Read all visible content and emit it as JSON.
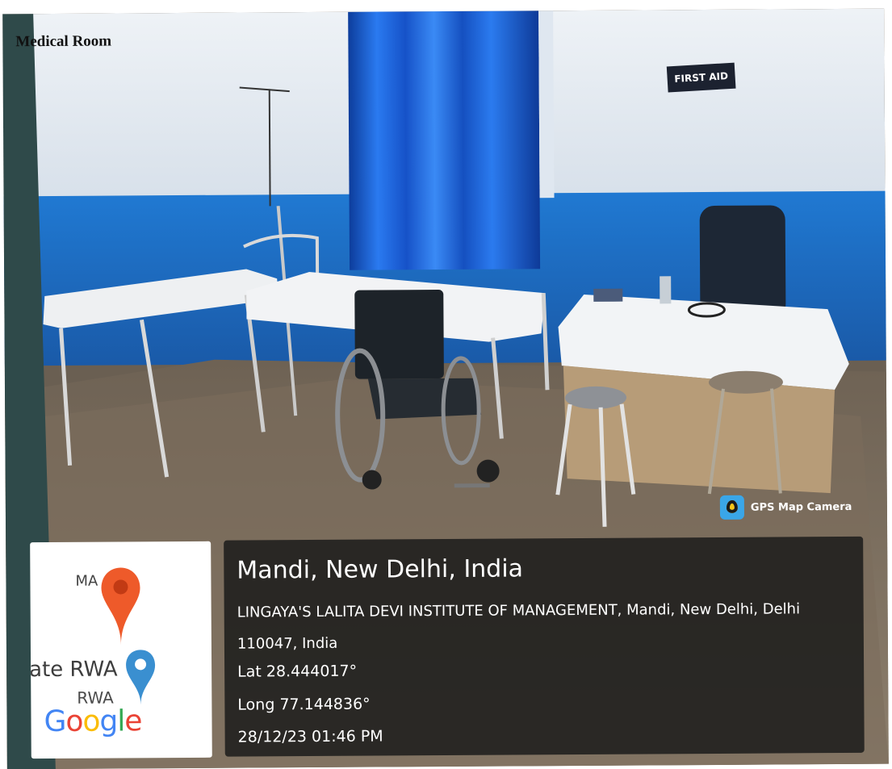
{
  "caption": "Medical Room",
  "sign_text": "FIRST AID",
  "gps_badge": {
    "app_name": "GPS Map Camera",
    "icon": "gps-map-camera-app-icon"
  },
  "map_tile": {
    "label_top": "MA",
    "label_rwa_large": "ate RWA",
    "label_rwa_small": "RWA",
    "google_logo": "Google",
    "pin_icons": [
      "location-pin-red-icon",
      "location-pin-blue-icon"
    ]
  },
  "location": {
    "place": "Mandi, New Delhi, India",
    "address": "LINGAYA'S LALITA DEVI INSTITUTE OF MANAGEMENT, Mandi, New Delhi, Delhi 110047, India",
    "latitude": "Lat 28.444017°",
    "longitude": "Long 77.144836°",
    "timestamp": "28/12/23  01:46 PM"
  },
  "colors": {
    "wall_blue": "#1e6fc8",
    "wall_white": "#e8eef4",
    "curtain": "#1f5fd6",
    "overlay": "#1e1e1c"
  }
}
